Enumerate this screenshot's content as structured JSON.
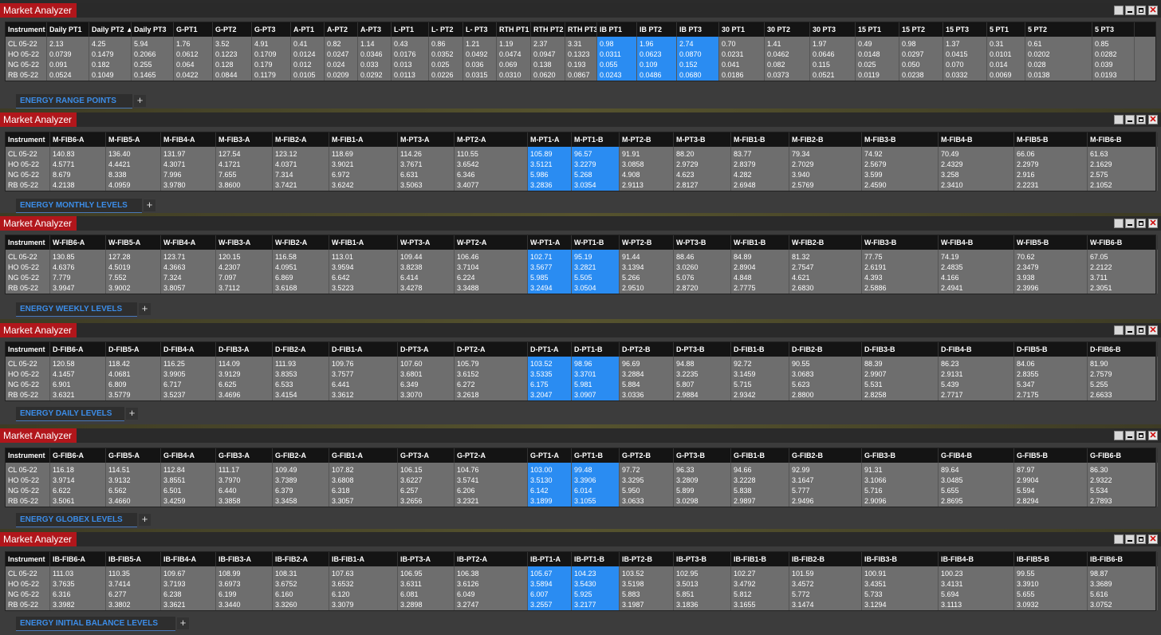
{
  "window_title": "Market Analyzer",
  "instruments": [
    "CL 05-22",
    "HO 05-22",
    "NG 05-22",
    "RB 05-22"
  ],
  "instrument_header": "Instrument",
  "panels": [
    {
      "tab": "ENERGY RANGE POINTS",
      "columns": [
        {
          "h": "Daily PT1",
          "v": [
            "2.13",
            "0.0739",
            "0.091",
            "0.0524"
          ]
        },
        {
          "h": "Daily PT2 ▲",
          "v": [
            "4.25",
            "0.1479",
            "0.182",
            "0.1049"
          ]
        },
        {
          "h": "Daily PT3",
          "v": [
            "5.94",
            "0.2066",
            "0.255",
            "0.1465"
          ]
        },
        {
          "h": "G-PT1",
          "v": [
            "1.76",
            "0.0612",
            "0.064",
            "0.0422"
          ]
        },
        {
          "h": "G-PT2",
          "v": [
            "3.52",
            "0.1223",
            "0.128",
            "0.0844"
          ]
        },
        {
          "h": "G-PT3",
          "v": [
            "4.91",
            "0.1709",
            "0.179",
            "0.1179"
          ]
        },
        {
          "h": "A-PT1",
          "v": [
            "0.41",
            "0.0124",
            "0.012",
            "0.0105"
          ]
        },
        {
          "h": "A-PT2",
          "v": [
            "0.82",
            "0.0247",
            "0.024",
            "0.0209"
          ]
        },
        {
          "h": "A-PT3",
          "v": [
            "1.14",
            "0.0346",
            "0.033",
            "0.0292"
          ]
        },
        {
          "h": "L-PT1",
          "v": [
            "0.43",
            "0.0176",
            "0.013",
            "0.0113"
          ]
        },
        {
          "h": "L- PT2",
          "v": [
            "0.86",
            "0.0352",
            "0.025",
            "0.0226"
          ]
        },
        {
          "h": "L- PT3",
          "v": [
            "1.21",
            "0.0492",
            "0.036",
            "0.0315"
          ]
        },
        {
          "h": "RTH PT1",
          "v": [
            "1.19",
            "0.0474",
            "0.069",
            "0.0310"
          ]
        },
        {
          "h": "RTH PT2",
          "v": [
            "2.37",
            "0.0947",
            "0.138",
            "0.0620"
          ]
        },
        {
          "h": "RTH PT3",
          "v": [
            "3.31",
            "0.1323",
            "0.193",
            "0.0867"
          ]
        },
        {
          "h": "IB PT1",
          "v": [
            "0.98",
            "0.0311",
            "0.055",
            "0.0243"
          ],
          "hl": true
        },
        {
          "h": "IB PT2",
          "v": [
            "1.96",
            "0.0623",
            "0.109",
            "0.0486"
          ],
          "hl": true
        },
        {
          "h": "IB PT3",
          "v": [
            "2.74",
            "0.0870",
            "0.152",
            "0.0680"
          ],
          "hl": true
        },
        {
          "h": "30 PT1",
          "v": [
            "0.70",
            "0.0231",
            "0.041",
            "0.0186"
          ]
        },
        {
          "h": "30 PT2",
          "v": [
            "1.41",
            "0.0462",
            "0.082",
            "0.0373"
          ]
        },
        {
          "h": "30 PT3",
          "v": [
            "1.97",
            "0.0646",
            "0.115",
            "0.0521"
          ]
        },
        {
          "h": "15 PT1",
          "v": [
            "0.49",
            "0.0148",
            "0.025",
            "0.0119"
          ]
        },
        {
          "h": "15 PT2",
          "v": [
            "0.98",
            "0.0297",
            "0.050",
            "0.0238"
          ]
        },
        {
          "h": "15 PT3",
          "v": [
            "1.37",
            "0.0415",
            "0.070",
            "0.0332"
          ]
        },
        {
          "h": "5 PT1",
          "v": [
            "0.31",
            "0.0101",
            "0.014",
            "0.0069"
          ]
        },
        {
          "h": "5 PT2",
          "v": [
            "0.61",
            "0.0202",
            "0.028",
            "0.0138"
          ]
        },
        {
          "h": "5 PT3",
          "v": [
            "0.85",
            "0.0282",
            "0.039",
            "0.0193"
          ]
        }
      ]
    },
    {
      "tab": "ENERGY MONTHLY LEVELS",
      "columns": [
        {
          "h": "M-FIB6-A",
          "v": [
            "140.83",
            "4.5771",
            "8.679",
            "4.2138"
          ]
        },
        {
          "h": "M-FIB5-A",
          "v": [
            "136.40",
            "4.4421",
            "8.338",
            "4.0959"
          ]
        },
        {
          "h": "M-FIB4-A",
          "v": [
            "131.97",
            "4.3071",
            "7.996",
            "3.9780"
          ]
        },
        {
          "h": "M-FIB3-A",
          "v": [
            "127.54",
            "4.1721",
            "7.655",
            "3.8600"
          ]
        },
        {
          "h": "M-FIB2-A",
          "v": [
            "123.12",
            "4.0371",
            "7.314",
            "3.7421"
          ]
        },
        {
          "h": "M-FIB1-A",
          "v": [
            "118.69",
            "3.9021",
            "6.972",
            "3.6242"
          ]
        },
        {
          "h": "M-PT3-A",
          "v": [
            "114.26",
            "3.7671",
            "6.631",
            "3.5063"
          ]
        },
        {
          "h": "M-PT2-A",
          "v": [
            "110.55",
            "3.6542",
            "6.346",
            "3.4077"
          ]
        },
        {
          "h": "M-PT1-A",
          "v": [
            "105.89",
            "3.5121",
            "5.986",
            "3.2836"
          ],
          "hl": true
        },
        {
          "h": "M-PT1-B",
          "v": [
            "96.57",
            "3.2279",
            "5.268",
            "3.0354"
          ],
          "hl": true
        },
        {
          "h": "M-PT2-B",
          "v": [
            "91.91",
            "3.0858",
            "4.908",
            "2.9113"
          ]
        },
        {
          "h": "M-PT3-B",
          "v": [
            "88.20",
            "2.9729",
            "4.623",
            "2.8127"
          ]
        },
        {
          "h": "M-FIB1-B",
          "v": [
            "83.77",
            "2.8379",
            "4.282",
            "2.6948"
          ]
        },
        {
          "h": "M-FIB2-B",
          "v": [
            "79.34",
            "2.7029",
            "3.940",
            "2.5769"
          ]
        },
        {
          "h": "M-FIB3-B",
          "v": [
            "74.92",
            "2.5679",
            "3.599",
            "2.4590"
          ]
        },
        {
          "h": "M-FIB4-B",
          "v": [
            "70.49",
            "2.4329",
            "3.258",
            "2.3410"
          ]
        },
        {
          "h": "M-FIB5-B",
          "v": [
            "66.06",
            "2.2979",
            "2.916",
            "2.2231"
          ]
        },
        {
          "h": "M-FIB6-B",
          "v": [
            "61.63",
            "2.1629",
            "2.575",
            "2.1052"
          ]
        }
      ]
    },
    {
      "tab": "ENERGY WEEKLY LEVELS",
      "columns": [
        {
          "h": "W-FIB6-A",
          "v": [
            "130.85",
            "4.6376",
            "7.779",
            "3.9947"
          ]
        },
        {
          "h": "W-FIB5-A",
          "v": [
            "127.28",
            "4.5019",
            "7.552",
            "3.9002"
          ]
        },
        {
          "h": "W-FIB4-A",
          "v": [
            "123.71",
            "4.3663",
            "7.324",
            "3.8057"
          ]
        },
        {
          "h": "W-FIB3-A",
          "v": [
            "120.15",
            "4.2307",
            "7.097",
            "3.7112"
          ]
        },
        {
          "h": "W-FIB2-A",
          "v": [
            "116.58",
            "4.0951",
            "6.869",
            "3.6168"
          ]
        },
        {
          "h": "W-FIB1-A",
          "v": [
            "113.01",
            "3.9594",
            "6.642",
            "3.5223"
          ]
        },
        {
          "h": "W-PT3-A",
          "v": [
            "109.44",
            "3.8238",
            "6.414",
            "3.4278"
          ]
        },
        {
          "h": "W-PT2-A",
          "v": [
            "106.46",
            "3.7104",
            "6.224",
            "3.3488"
          ]
        },
        {
          "h": "W-PT1-A",
          "v": [
            "102.71",
            "3.5677",
            "5.985",
            "3.2494"
          ],
          "hl": true
        },
        {
          "h": "W-PT1-B",
          "v": [
            "95.19",
            "3.2821",
            "5.505",
            "3.0504"
          ],
          "hl": true
        },
        {
          "h": "W-PT2-B",
          "v": [
            "91.44",
            "3.1394",
            "5.266",
            "2.9510"
          ]
        },
        {
          "h": "W-PT3-B",
          "v": [
            "88.46",
            "3.0260",
            "5.076",
            "2.8720"
          ]
        },
        {
          "h": "W-FIB1-B",
          "v": [
            "84.89",
            "2.8904",
            "4.848",
            "2.7775"
          ]
        },
        {
          "h": "W-FIB2-B",
          "v": [
            "81.32",
            "2.7547",
            "4.621",
            "2.6830"
          ]
        },
        {
          "h": "W-FIB3-B",
          "v": [
            "77.75",
            "2.6191",
            "4.393",
            "2.5886"
          ]
        },
        {
          "h": "W-FIB4-B",
          "v": [
            "74.19",
            "2.4835",
            "4.166",
            "2.4941"
          ]
        },
        {
          "h": "W-FIB5-B",
          "v": [
            "70.62",
            "2.3479",
            "3.938",
            "2.3996"
          ]
        },
        {
          "h": "W-FIB6-B",
          "v": [
            "67.05",
            "2.2122",
            "3.711",
            "2.3051"
          ]
        }
      ]
    },
    {
      "tab": "ENERGY DAILY LEVELS",
      "columns": [
        {
          "h": "D-FIB6-A",
          "v": [
            "120.58",
            "4.1457",
            "6.901",
            "3.6321"
          ]
        },
        {
          "h": "D-FIB5-A",
          "v": [
            "118.42",
            "4.0681",
            "6.809",
            "3.5779"
          ]
        },
        {
          "h": "D-FIB4-A",
          "v": [
            "116.25",
            "3.9905",
            "6.717",
            "3.5237"
          ]
        },
        {
          "h": "D-FIB3-A",
          "v": [
            "114.09",
            "3.9129",
            "6.625",
            "3.4696"
          ]
        },
        {
          "h": "D-FIB2-A",
          "v": [
            "111.93",
            "3.8353",
            "6.533",
            "3.4154"
          ]
        },
        {
          "h": "D-FIB1-A",
          "v": [
            "109.76",
            "3.7577",
            "6.441",
            "3.3612"
          ]
        },
        {
          "h": "D-PT3-A",
          "v": [
            "107.60",
            "3.6801",
            "6.349",
            "3.3070"
          ]
        },
        {
          "h": "D-PT2-A",
          "v": [
            "105.79",
            "3.6152",
            "6.272",
            "3.2618"
          ]
        },
        {
          "h": "D-PT1-A",
          "v": [
            "103.52",
            "3.5335",
            "6.175",
            "3.2047"
          ],
          "hl": true
        },
        {
          "h": "D-PT1-B",
          "v": [
            "98.96",
            "3.3701",
            "5.981",
            "3.0907"
          ],
          "hl": true
        },
        {
          "h": "D-PT2-B",
          "v": [
            "96.69",
            "3.2884",
            "5.884",
            "3.0336"
          ]
        },
        {
          "h": "D-PT3-B",
          "v": [
            "94.88",
            "3.2235",
            "5.807",
            "2.9884"
          ]
        },
        {
          "h": "D-FIB1-B",
          "v": [
            "92.72",
            "3.1459",
            "5.715",
            "2.9342"
          ]
        },
        {
          "h": "D-FIB2-B",
          "v": [
            "90.55",
            "3.0683",
            "5.623",
            "2.8800"
          ]
        },
        {
          "h": "D-FIB3-B",
          "v": [
            "88.39",
            "2.9907",
            "5.531",
            "2.8258"
          ]
        },
        {
          "h": "D-FIB4-B",
          "v": [
            "86.23",
            "2.9131",
            "5.439",
            "2.7717"
          ]
        },
        {
          "h": "D-FIB5-B",
          "v": [
            "84.06",
            "2.8355",
            "5.347",
            "2.7175"
          ]
        },
        {
          "h": "D-FIB6-B",
          "v": [
            "81.90",
            "2.7579",
            "5.255",
            "2.6633"
          ]
        }
      ]
    },
    {
      "tab": "ENERGY GLOBEX LEVELS",
      "columns": [
        {
          "h": "G-FIB6-A",
          "v": [
            "116.18",
            "3.9714",
            "6.622",
            "3.5061"
          ]
        },
        {
          "h": "G-FIB5-A",
          "v": [
            "114.51",
            "3.9132",
            "6.562",
            "3.4660"
          ]
        },
        {
          "h": "G-FIB4-A",
          "v": [
            "112.84",
            "3.8551",
            "6.501",
            "3.4259"
          ]
        },
        {
          "h": "G-FIB3-A",
          "v": [
            "111.17",
            "3.7970",
            "6.440",
            "3.3858"
          ]
        },
        {
          "h": "G-FIB2-A",
          "v": [
            "109.49",
            "3.7389",
            "6.379",
            "3.3458"
          ]
        },
        {
          "h": "G-FIB1-A",
          "v": [
            "107.82",
            "3.6808",
            "6.318",
            "3.3057"
          ]
        },
        {
          "h": "G-PT3-A",
          "v": [
            "106.15",
            "3.6227",
            "6.257",
            "3.2656"
          ]
        },
        {
          "h": "G-PT2-A",
          "v": [
            "104.76",
            "3.5741",
            "6.206",
            "3.2321"
          ]
        },
        {
          "h": "G-PT1-A",
          "v": [
            "103.00",
            "3.5130",
            "6.142",
            "3.1899"
          ],
          "hl": true
        },
        {
          "h": "G-PT1-B",
          "v": [
            "99.48",
            "3.3906",
            "6.014",
            "3.1055"
          ],
          "hl": true
        },
        {
          "h": "G-PT2-B",
          "v": [
            "97.72",
            "3.3295",
            "5.950",
            "3.0633"
          ]
        },
        {
          "h": "G-PT3-B",
          "v": [
            "96.33",
            "3.2809",
            "5.899",
            "3.0298"
          ]
        },
        {
          "h": "G-FIB1-B",
          "v": [
            "94.66",
            "3.2228",
            "5.838",
            "2.9897"
          ]
        },
        {
          "h": "G-FIB2-B",
          "v": [
            "92.99",
            "3.1647",
            "5.777",
            "2.9496"
          ]
        },
        {
          "h": "G-FIB3-B",
          "v": [
            "91.31",
            "3.1066",
            "5.716",
            "2.9096"
          ]
        },
        {
          "h": "G-FIB4-B",
          "v": [
            "89.64",
            "3.0485",
            "5.655",
            "2.8695"
          ]
        },
        {
          "h": "G-FIB5-B",
          "v": [
            "87.97",
            "2.9904",
            "5.594",
            "2.8294"
          ]
        },
        {
          "h": "G-FIB6-B",
          "v": [
            "86.30",
            "2.9322",
            "5.534",
            "2.7893"
          ]
        }
      ]
    },
    {
      "tab": "ENERGY INITIAL BALANCE LEVELS",
      "columns": [
        {
          "h": "IB-FIB6-A",
          "v": [
            "111.03",
            "3.7635",
            "6.316",
            "3.3982"
          ]
        },
        {
          "h": "IB-FIB5-A",
          "v": [
            "110.35",
            "3.7414",
            "6.277",
            "3.3802"
          ]
        },
        {
          "h": "IB-FIB4-A",
          "v": [
            "109.67",
            "3.7193",
            "6.238",
            "3.3621"
          ]
        },
        {
          "h": "IB-FIB3-A",
          "v": [
            "108.99",
            "3.6973",
            "6.199",
            "3.3440"
          ]
        },
        {
          "h": "IB-FIB2-A",
          "v": [
            "108.31",
            "3.6752",
            "6.160",
            "3.3260"
          ]
        },
        {
          "h": "IB-FIB1-A",
          "v": [
            "107.63",
            "3.6532",
            "6.120",
            "3.3079"
          ]
        },
        {
          "h": "IB-PT3-A",
          "v": [
            "106.95",
            "3.6311",
            "6.081",
            "3.2898"
          ]
        },
        {
          "h": "IB-PT2-A",
          "v": [
            "106.38",
            "3.6126",
            "6.049",
            "3.2747"
          ]
        },
        {
          "h": "IB-PT1-A",
          "v": [
            "105.67",
            "3.5894",
            "6.007",
            "3.2557"
          ],
          "hl": true
        },
        {
          "h": "IB-PT1-B",
          "v": [
            "104.23",
            "3.5430",
            "5.925",
            "3.2177"
          ],
          "hl": true
        },
        {
          "h": "IB-PT2-B",
          "v": [
            "103.52",
            "3.5198",
            "5.883",
            "3.1987"
          ]
        },
        {
          "h": "IB-PT3-B",
          "v": [
            "102.95",
            "3.5013",
            "5.851",
            "3.1836"
          ]
        },
        {
          "h": "IB-FIB1-B",
          "v": [
            "102.27",
            "3.4792",
            "5.812",
            "3.1655"
          ]
        },
        {
          "h": "IB-FIB2-B",
          "v": [
            "101.59",
            "3.4572",
            "5.772",
            "3.1474"
          ]
        },
        {
          "h": "IB-FIB3-B",
          "v": [
            "100.91",
            "3.4351",
            "5.733",
            "3.1294"
          ]
        },
        {
          "h": "IB-FIB4-B",
          "v": [
            "100.23",
            "3.4131",
            "5.694",
            "3.1113"
          ]
        },
        {
          "h": "IB-FIB5-B",
          "v": [
            "99.55",
            "3.3910",
            "5.655",
            "3.0932"
          ]
        },
        {
          "h": "IB-FIB6-B",
          "v": [
            "98.87",
            "3.3689",
            "5.616",
            "3.0752"
          ]
        }
      ]
    }
  ]
}
